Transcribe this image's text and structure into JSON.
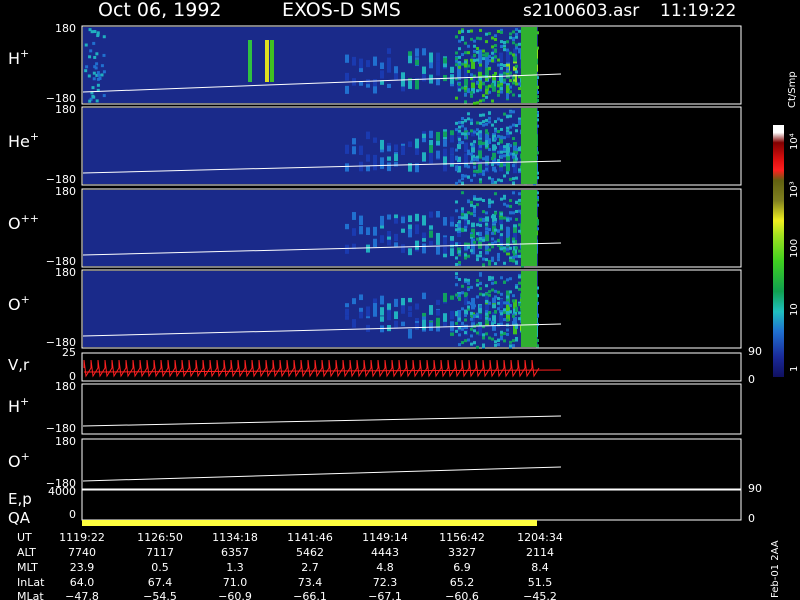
{
  "header": {
    "date": "Oct 06, 1992",
    "title": "EXOS-D SMS",
    "file": "s2100603.asr",
    "time": "11:19:22"
  },
  "colors": {
    "background": "#000000",
    "spectrogram_fill": "#1a2a8a",
    "qa_bar": "#ffff40",
    "vr_trace": "#ff2020",
    "axis": "#ffffff"
  },
  "panels": [
    {
      "label": "H",
      "sup": "+",
      "ytop": "180",
      "ybot": "−180"
    },
    {
      "label": "He",
      "sup": "+",
      "ytop": "180",
      "ybot": "−180"
    },
    {
      "label": "O",
      "sup": "++",
      "ytop": "180",
      "ybot": "−180"
    },
    {
      "label": "O",
      "sup": "+",
      "ytop": "180",
      "ybot": "−180"
    }
  ],
  "vr_panel": {
    "label": "V,r",
    "ytop": "25",
    "ybot": "0",
    "right_top": "90",
    "right_bot": "0"
  },
  "line_panels": [
    {
      "label": "H",
      "sup": "+",
      "ytop": "180",
      "ybot": "−180"
    },
    {
      "label": "O",
      "sup": "+",
      "ytop": "180",
      "ybot": "−180"
    }
  ],
  "ep_panel": {
    "label": "E,p",
    "ytop": "4000",
    "ybot": "0",
    "right_top": "90",
    "right_bot": "0"
  },
  "qa_panel": {
    "label": "QA"
  },
  "colorbar": {
    "title": "Ct/Smp",
    "labels": [
      "10",
      "4",
      "10",
      "3",
      "100",
      "10",
      "1"
    ],
    "tick_texts": [
      "1",
      "10",
      "100",
      "10³",
      "10⁴"
    ]
  },
  "ephemeris": {
    "labels": [
      "UT",
      "ALT",
      "MLT",
      "InLat",
      "MLat"
    ],
    "columns": [
      {
        "ut": "1119:22",
        "alt": "7740",
        "mlt": "23.9",
        "inlat": "64.0",
        "mlat": "−47.8"
      },
      {
        "ut": "1126:50",
        "alt": "7117",
        "mlt": "0.5",
        "inlat": "67.4",
        "mlat": "−54.5"
      },
      {
        "ut": "1134:18",
        "alt": "6357",
        "mlt": "1.3",
        "inlat": "71.0",
        "mlat": "−60.9"
      },
      {
        "ut": "1141:46",
        "alt": "5462",
        "mlt": "2.7",
        "inlat": "73.4",
        "mlat": "−66.1"
      },
      {
        "ut": "1149:14",
        "alt": "4443",
        "mlt": "4.8",
        "inlat": "72.3",
        "mlat": "−67.1"
      },
      {
        "ut": "1156:42",
        "alt": "3327",
        "mlt": "6.9",
        "inlat": "65.2",
        "mlat": "−60.6"
      },
      {
        "ut": "1204:34",
        "alt": "2114",
        "mlt": "8.4",
        "inlat": "51.5",
        "mlat": "−45.2"
      }
    ]
  },
  "footer_note": "Feb-01 2AA",
  "chart_data": {
    "type": "heatmap",
    "title": "EXOS-D SMS",
    "xlabel": "UT",
    "x_ticks": [
      "1119:22",
      "1126:50",
      "1134:18",
      "1141:46",
      "1149:14",
      "1156:42",
      "1204:34"
    ],
    "series": [
      {
        "name": "H+",
        "ylim": [
          -180,
          180
        ]
      },
      {
        "name": "He+",
        "ylim": [
          -180,
          180
        ]
      },
      {
        "name": "O++",
        "ylim": [
          -180,
          180
        ]
      },
      {
        "name": "O+",
        "ylim": [
          -180,
          180
        ]
      },
      {
        "name": "V,r",
        "ylim": [
          0,
          25
        ]
      },
      {
        "name": "E,p",
        "ylim": [
          0,
          4000
        ]
      }
    ],
    "colorbar_label": "Ct/Smp",
    "colorbar_scale": "log",
    "colorbar_range": [
      1,
      10000
    ]
  }
}
